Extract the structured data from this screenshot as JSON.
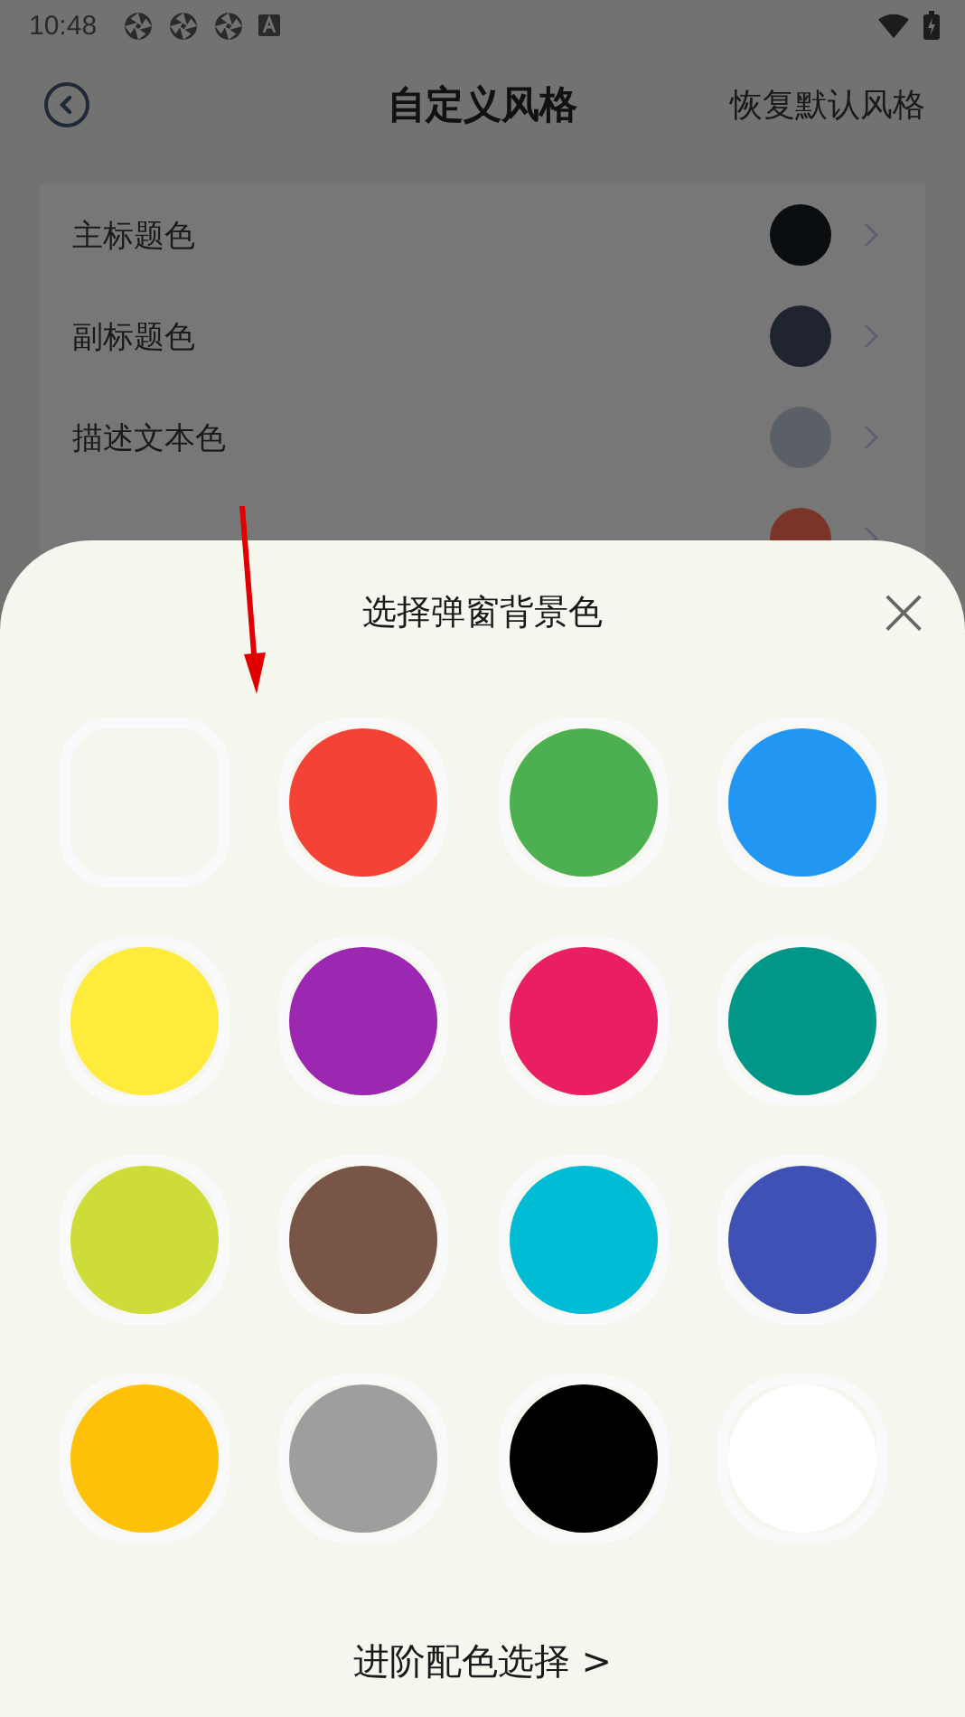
{
  "status_bar": {
    "time": "10:48"
  },
  "header": {
    "title": "自定义风格",
    "action": "恢复默认风格"
  },
  "settings": [
    {
      "label": "主标题色",
      "color": "#0b0e11"
    },
    {
      "label": "副标题色",
      "color": "#1f2430"
    },
    {
      "label": "描述文本色",
      "color": "#5b6066"
    },
    {
      "color": "#7a3428"
    }
  ],
  "sheet": {
    "title": "选择弹窗背景色",
    "close": "×",
    "swatches": [
      {
        "kind": "none"
      },
      {
        "kind": "color",
        "color": "#f44336"
      },
      {
        "kind": "color",
        "color": "#4caf50"
      },
      {
        "kind": "color",
        "color": "#2196f3"
      },
      {
        "kind": "color",
        "color": "#ffeb3b"
      },
      {
        "kind": "color",
        "color": "#9c27b0"
      },
      {
        "kind": "color",
        "color": "#e91e63"
      },
      {
        "kind": "color",
        "color": "#009688"
      },
      {
        "kind": "color",
        "color": "#cddc39"
      },
      {
        "kind": "color",
        "color": "#795548"
      },
      {
        "kind": "color",
        "color": "#00bcd4"
      },
      {
        "kind": "color",
        "color": "#3f51b5"
      },
      {
        "kind": "color",
        "color": "#ffc107"
      },
      {
        "kind": "color",
        "color": "#9e9e9e"
      },
      {
        "kind": "color",
        "color": "#000000"
      },
      {
        "kind": "color",
        "color": "#ffffff"
      }
    ],
    "advanced_link": "进阶配色选择 >"
  }
}
